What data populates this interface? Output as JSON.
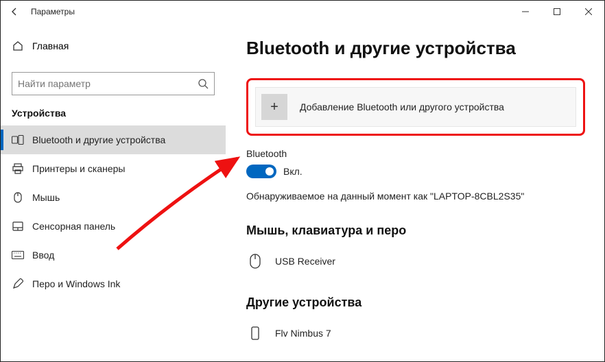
{
  "titlebar": {
    "app_title": "Параметры"
  },
  "sidebar": {
    "home_label": "Главная",
    "search_placeholder": "Найти параметр",
    "section_title": "Устройства",
    "items": [
      {
        "label": "Bluetooth и другие устройства"
      },
      {
        "label": "Принтеры и сканеры"
      },
      {
        "label": "Мышь"
      },
      {
        "label": "Сенсорная панель"
      },
      {
        "label": "Ввод"
      },
      {
        "label": "Перо и Windows Ink"
      }
    ]
  },
  "main": {
    "title": "Bluetooth и другие устройства",
    "add_device_label": "Добавление Bluetooth или другого устройства",
    "bluetooth_heading": "Bluetooth",
    "toggle_label": "Вкл.",
    "discover_text": "Обнаруживаемое на данный момент как \"LAPTOP-8CBL2S35\"",
    "group1_heading": "Мышь, клавиатура и перо",
    "device1_label": "USB Receiver",
    "group2_heading": "Другие устройства",
    "device2_label": "Flv Nimbus 7"
  }
}
